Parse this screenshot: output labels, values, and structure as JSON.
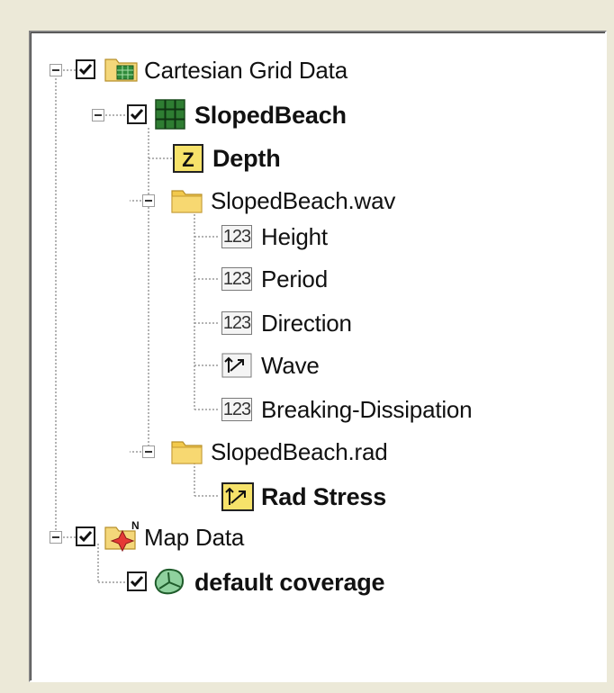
{
  "tree": {
    "cartesian_root": {
      "label": "Cartesian Grid Data",
      "checked": true,
      "icon": "folder-grid-icon"
    },
    "sloped_beach": {
      "label": "SlopedBeach",
      "checked": true,
      "icon": "grid-icon"
    },
    "depth": {
      "label": "Depth",
      "icon": "z-dataset-icon",
      "icon_text": "Z"
    },
    "wav_folder": {
      "label": "SlopedBeach.wav",
      "icon": "folder-icon"
    },
    "height": {
      "label": "Height",
      "icon": "scalar-dataset-icon",
      "icon_text": "123"
    },
    "period": {
      "label": "Period",
      "icon": "scalar-dataset-icon",
      "icon_text": "123"
    },
    "direction": {
      "label": "Direction",
      "icon": "scalar-dataset-icon",
      "icon_text": "123"
    },
    "wave": {
      "label": "Wave",
      "icon": "vector-dataset-icon"
    },
    "breaking": {
      "label": "Breaking-Dissipation",
      "icon": "scalar-dataset-icon",
      "icon_text": "123"
    },
    "rad_folder": {
      "label": "SlopedBeach.rad",
      "icon": "folder-icon"
    },
    "rad_stress": {
      "label": "Rad Stress",
      "icon": "vector-dataset-active-icon"
    },
    "map_root": {
      "label": "Map Data",
      "checked": true,
      "icon": "map-data-icon"
    },
    "default_coverage": {
      "label": "default coverage",
      "checked": true,
      "icon": "coverage-icon"
    }
  },
  "colors": {
    "window_bg": "#ece9d8",
    "tree_bg": "#ffffff",
    "grid_green": "#2e7d32",
    "folder_yellow": "#f2c94c"
  }
}
